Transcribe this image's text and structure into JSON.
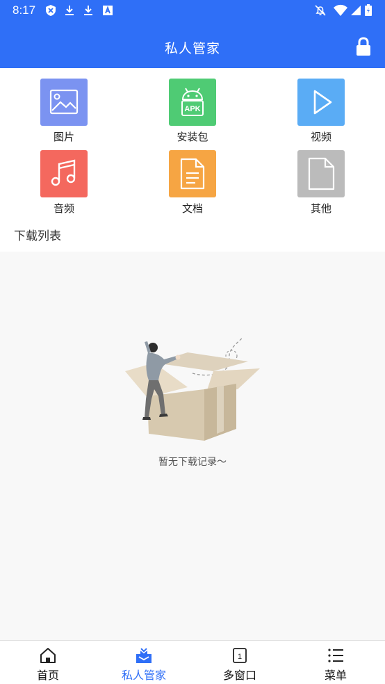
{
  "status_bar": {
    "time": "8:17",
    "left_icons": [
      "shield-icon",
      "download-icon",
      "download-icon",
      "font-icon"
    ],
    "right_icons": [
      "bell-off-icon",
      "wifi-icon",
      "signal-icon",
      "battery-icon"
    ]
  },
  "header": {
    "title": "私人管家",
    "action_icon": "lock-icon",
    "color": "#2f6ff7"
  },
  "categories": [
    {
      "label": "图片",
      "icon": "image-icon",
      "color": "#7b93f1"
    },
    {
      "label": "安装包",
      "icon": "android-apk-icon",
      "color": "#4fcb74"
    },
    {
      "label": "视频",
      "icon": "play-icon",
      "color": "#5aacf5"
    },
    {
      "label": "音频",
      "icon": "music-note-icon",
      "color": "#f4685e"
    },
    {
      "label": "文档",
      "icon": "document-icon",
      "color": "#f6a543"
    },
    {
      "label": "其他",
      "icon": "file-icon",
      "color": "#bbbbbb"
    }
  ],
  "downloads": {
    "title": "下载列表",
    "empty_text": "暂无下载记录～",
    "empty_illustration": "person-with-box-illustration"
  },
  "bottom_nav": {
    "items": [
      {
        "label": "首页",
        "icon": "home-icon",
        "active": false
      },
      {
        "label": "私人管家",
        "icon": "butler-icon",
        "active": true
      },
      {
        "label": "多窗口",
        "icon": "windows-count-icon",
        "active": false,
        "badge": "1"
      },
      {
        "label": "菜单",
        "icon": "menu-list-icon",
        "active": false
      }
    ],
    "active_color": "#2f6ff7"
  }
}
